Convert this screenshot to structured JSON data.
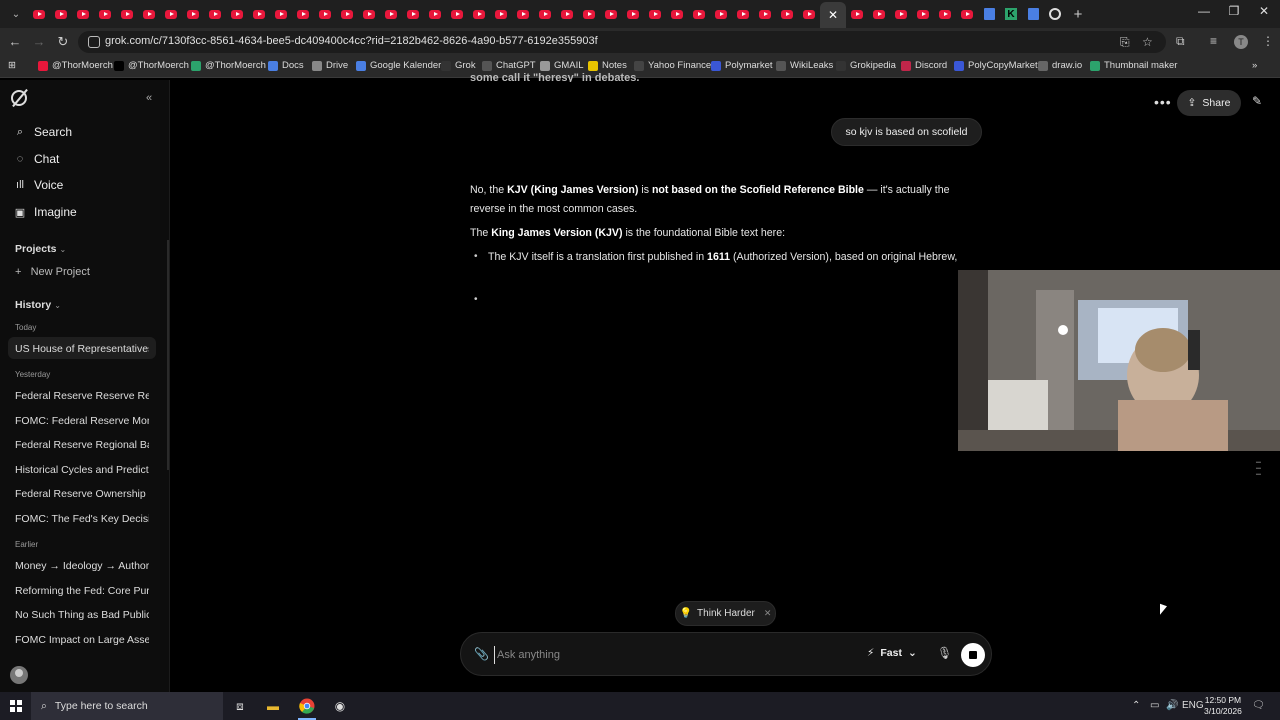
{
  "browser": {
    "url": "grok.com/c/7130f3cc-8561-4634-bee5-dc409400c4cc?rid=2182b462-8626-4a90-b577-6192e355903f",
    "bookmarks": [
      {
        "label": "@ThorMoerch",
        "icon": "youtube-icon",
        "color": "#e8173b"
      },
      {
        "label": "@ThorMoerch",
        "icon": "x-icon",
        "color": "#000000"
      },
      {
        "label": "@ThorMoerch",
        "icon": "kick-icon",
        "color": "#2ca36c"
      },
      {
        "label": "Docs",
        "icon": "docs-icon",
        "color": "#4a7fe3"
      },
      {
        "label": "Drive",
        "icon": "drive-icon",
        "color": "#888888"
      },
      {
        "label": "Google Kalender",
        "icon": "calendar-icon",
        "color": "#4a7fe3"
      },
      {
        "label": "Grok",
        "icon": "grok-icon",
        "color": "#333333"
      },
      {
        "label": "ChatGPT",
        "icon": "chatgpt-icon",
        "color": "#555555"
      },
      {
        "label": "GMAIL",
        "icon": "gmail-icon",
        "color": "#999999"
      },
      {
        "label": "Notes",
        "icon": "notes-icon",
        "color": "#e8c400"
      },
      {
        "label": "Yahoo Finance",
        "icon": "yahoo-icon",
        "color": "#444444"
      },
      {
        "label": "Polymarket",
        "icon": "polymarket-icon",
        "color": "#3a57d6"
      },
      {
        "label": "WikiLeaks",
        "icon": "wikileaks-icon",
        "color": "#555555"
      },
      {
        "label": "Grokipedia",
        "icon": "grokipedia-icon",
        "color": "#333333"
      },
      {
        "label": "Discord",
        "icon": "discord-icon",
        "color": "#c0264a"
      },
      {
        "label": "PolyCopyMarket",
        "icon": "polycopy-icon",
        "color": "#3a57d6"
      },
      {
        "label": "draw.io",
        "icon": "drawio-icon",
        "color": "#666666"
      },
      {
        "label": "Thumbnail maker",
        "icon": "thumbnail-icon",
        "color": "#2ca36c"
      }
    ]
  },
  "sidebar": {
    "nav": [
      {
        "label": "Search",
        "icon": "search-icon"
      },
      {
        "label": "Chat",
        "icon": "chat-icon"
      },
      {
        "label": "Voice",
        "icon": "voice-icon"
      },
      {
        "label": "Imagine",
        "icon": "imagine-icon"
      }
    ],
    "projects_label": "Projects",
    "new_project": "New Project",
    "history_label": "History",
    "groups": {
      "today": "Today",
      "yesterday": "Yesterday",
      "earlier": "Earlier"
    },
    "history_today": [
      "US House of Representatives ..."
    ],
    "history_yesterday": [
      "Federal Reserve Reserve Req...",
      "FOMC: Federal Reserve Mone...",
      "Federal Reserve Regional Ban...",
      "Historical Cycles and Predicti...",
      "Federal Reserve Ownership C...",
      "FOMC: The Fed's Key Decisio..."
    ],
    "history_earlier": [
      "Money → Ideology → Authorit...",
      "Reforming the Fed: Core Purp...",
      "No Such Thing as Bad Publicity",
      "FOMC Impact on Large Asset..."
    ]
  },
  "header": {
    "share_label": "Share"
  },
  "chat": {
    "cut_text": "some call it \"heresy\" in debates.",
    "user_message": "so kjv is based on scofield",
    "p1_a": "No, the ",
    "p1_b": "KJV (King James Version)",
    "p1_c": " is ",
    "p1_d": "not based on the Scofield Reference Bible",
    "p1_e": " — it's actually the reverse in the most common cases.",
    "p2_a": "The ",
    "p2_b": "King James Version (KJV)",
    "p2_c": " is the foundational Bible text here:",
    "b1_a": "The KJV itself is a translation first published in ",
    "b1_b": "1611",
    "b1_c": " (Authorized Version), based on original Hebrew,"
  },
  "composer": {
    "think_label": "Think Harder",
    "placeholder": "Ask anything",
    "mode_label": "Fast"
  },
  "taskbar": {
    "search_placeholder": "Type here to search",
    "lang": "ENG",
    "time": "12:50 PM",
    "date": "3/10/2026"
  }
}
